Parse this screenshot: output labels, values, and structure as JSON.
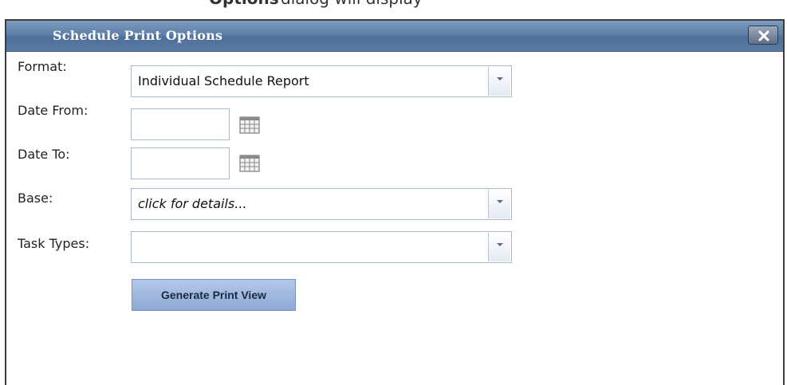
{
  "background_heading": {
    "bold_part": "Options",
    "rest": "dialog will display"
  },
  "dialog": {
    "title": "Schedule Print Options",
    "close_icon": "close-x-icon"
  },
  "form": {
    "format": {
      "label": "Format:",
      "value": "Individual Schedule Report"
    },
    "date_from": {
      "label": "Date From:",
      "value": ""
    },
    "date_to": {
      "label": "Date To:",
      "value": ""
    },
    "base": {
      "label": "Base:",
      "value": "click for details..."
    },
    "task_types": {
      "label": "Task Types:",
      "value": ""
    },
    "generate_button": "Generate Print View"
  },
  "colors": {
    "titlebar": "#5e7fa8",
    "button": "#9fb8e0",
    "field_border": "#a9b8d0"
  }
}
